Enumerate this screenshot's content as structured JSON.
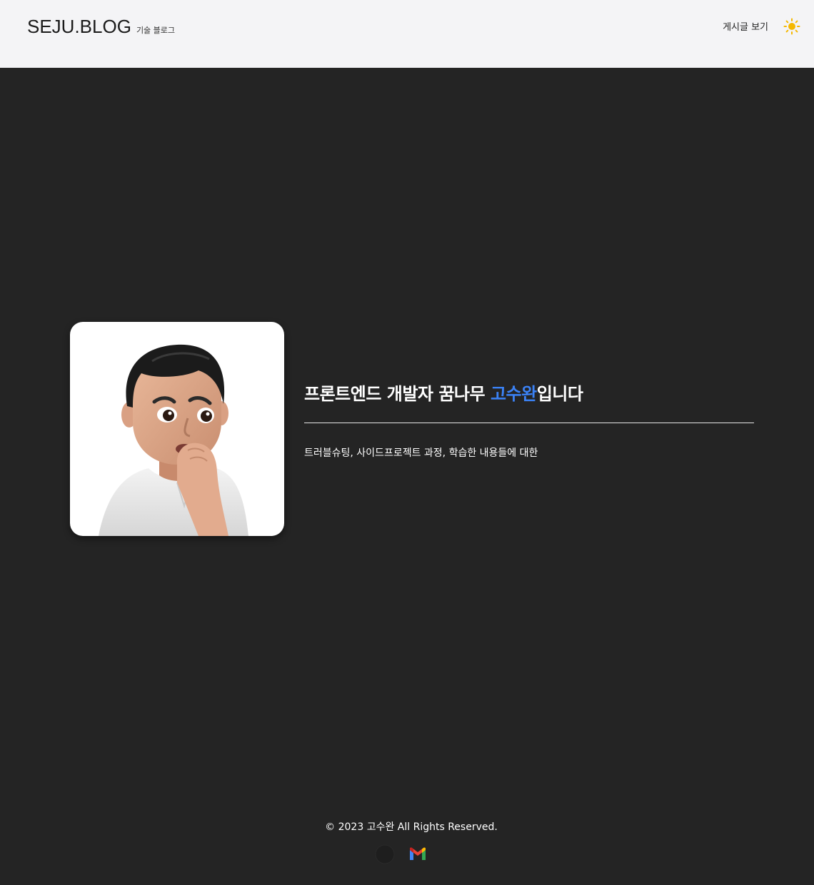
{
  "header": {
    "brand_title": "SEJU.BLOG",
    "brand_subtitle": "기술 블로그",
    "nav_posts": "게시글 보기",
    "theme_icon": "sun-icon",
    "theme_color": "#f5b800"
  },
  "hero": {
    "avatar_icon": "memoji-avatar",
    "headline_prefix": "프론트엔드 개발자 꿈나무 ",
    "headline_name": "고수완",
    "headline_suffix": "입니다",
    "description": "트러블슈팅, 사이드프로젝트 과정, 학습한 내용들에 대한",
    "accent_color": "#3b82f6"
  },
  "footer": {
    "copyright": "© 2023 고수완 All Rights Reserved.",
    "icons": [
      "github-icon",
      "gmail-icon"
    ]
  },
  "colors": {
    "header_bg": "#f4f4f6",
    "page_bg": "#242424"
  }
}
